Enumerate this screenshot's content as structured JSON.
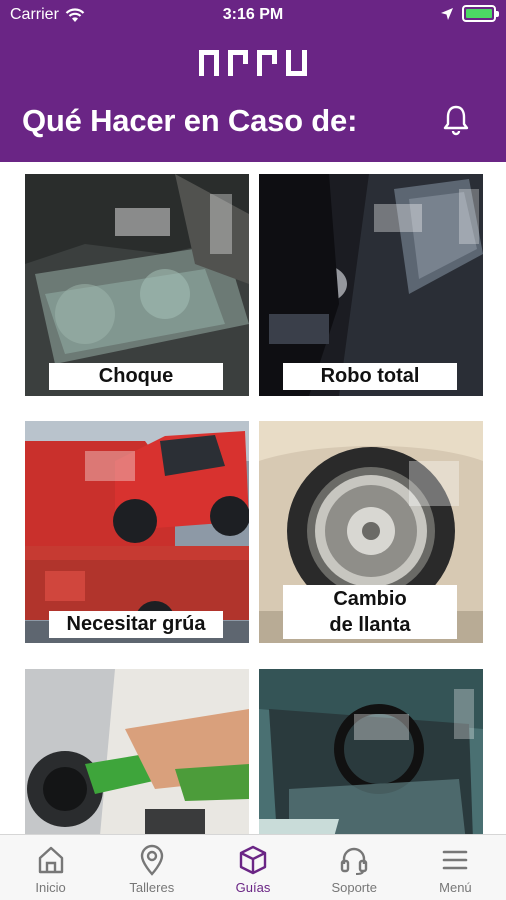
{
  "status_bar": {
    "carrier": "Carrier",
    "time": "3:16 PM"
  },
  "header": {
    "title": "Qué Hacer en Caso de:",
    "logo_icon": "brand-logo-icon",
    "bell_icon": "bell-icon"
  },
  "colors": {
    "brand": "#6a2585",
    "battery": "#4cd964",
    "tab_inactive": "#777777"
  },
  "tiles": [
    {
      "label": "Choque"
    },
    {
      "label": "Robo total"
    },
    {
      "label": "Necesitar grúa"
    },
    {
      "label_line1": "Cambio",
      "label_line2": "de llanta"
    },
    {
      "label": ""
    },
    {
      "label": ""
    }
  ],
  "tabs": [
    {
      "label": "Inicio",
      "icon": "home-icon"
    },
    {
      "label": "Talleres",
      "icon": "location-pin-icon"
    },
    {
      "label": "Guías",
      "icon": "cube-icon",
      "active": true
    },
    {
      "label": "Soporte",
      "icon": "headset-icon"
    },
    {
      "label": "Menú",
      "icon": "menu-icon"
    }
  ]
}
